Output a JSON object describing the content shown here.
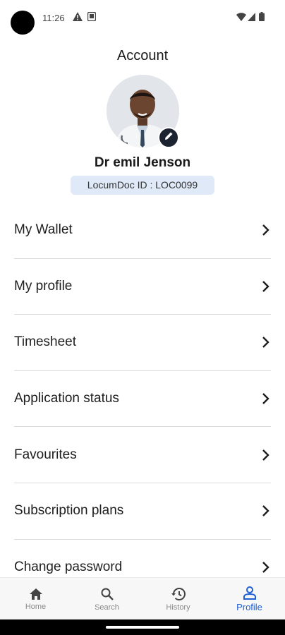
{
  "status_bar": {
    "time": "11:26"
  },
  "header": {
    "title": "Account"
  },
  "profile": {
    "name": "Dr emil Jenson",
    "id_label": "LocumDoc ID : LOC0099"
  },
  "menu": {
    "items": [
      {
        "label": "My Wallet"
      },
      {
        "label": "My profile"
      },
      {
        "label": "Timesheet"
      },
      {
        "label": "Application status"
      },
      {
        "label": "Favourites"
      },
      {
        "label": "Subscription plans"
      },
      {
        "label": "Change password"
      }
    ]
  },
  "bottom_nav": {
    "items": [
      {
        "label": "Home",
        "icon": "home-icon"
      },
      {
        "label": "Search",
        "icon": "search-icon"
      },
      {
        "label": "History",
        "icon": "history-icon"
      },
      {
        "label": "Profile",
        "icon": "person-icon",
        "active": true
      }
    ],
    "active_color": "#1f5fd6"
  }
}
